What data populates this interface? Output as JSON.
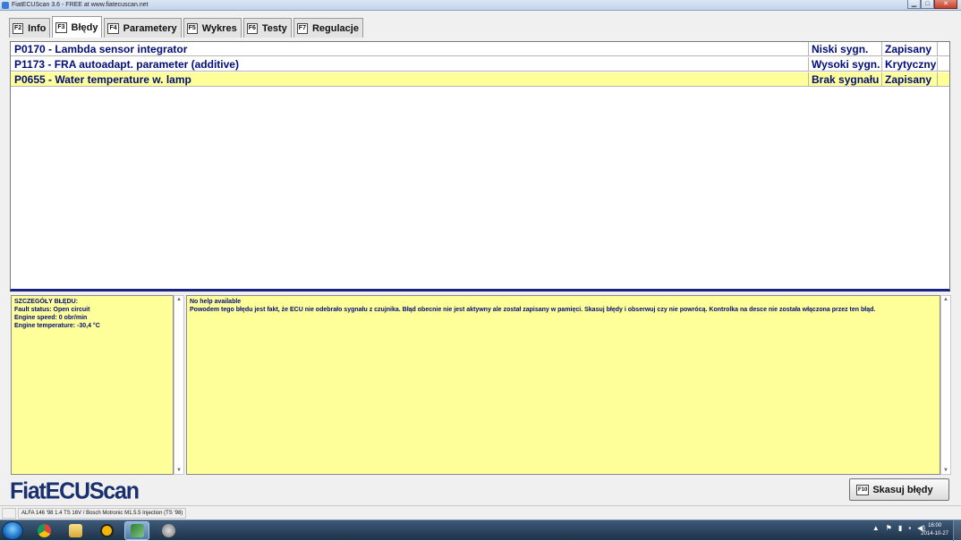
{
  "window": {
    "title": "FiatECUScan 3.6 - FREE at www.fiatecuscan.net"
  },
  "tabs": [
    {
      "key": "F2",
      "label": "Info"
    },
    {
      "key": "F3",
      "label": "Błędy"
    },
    {
      "key": "F4",
      "label": "Parametery"
    },
    {
      "key": "F5",
      "label": "Wykres"
    },
    {
      "key": "F6",
      "label": "Testy"
    },
    {
      "key": "F7",
      "label": "Regulacje"
    }
  ],
  "active_tab": "Błędy",
  "faults": [
    {
      "code_desc": "P0170 - Lambda sensor integrator",
      "signal": "Niski sygn.",
      "status": "Zapisany"
    },
    {
      "code_desc": "P1173 - FRA autoadapt. parameter (additive)",
      "signal": "Wysoki sygn.",
      "status": "Krytyczny"
    },
    {
      "code_desc": "P0655 - Water temperature w. lamp",
      "signal": "Brak sygnału",
      "status": "Zapisany"
    }
  ],
  "selected_fault_index": 2,
  "details": {
    "heading": "SZCZEGÓŁY BŁĘDU:",
    "lines": [
      "Fault status: Open circuit",
      "Engine speed: 0 obr/min",
      "Engine temperature: -30,4 °C"
    ]
  },
  "help": {
    "title": "No help available",
    "text": "Powodem tego błędu jest fakt, że ECU nie odebrało sygnału z czujnika. Błąd obecnie nie jest aktywny ale został zapisany w pamięci. Skasuj błędy i obserwuj czy nie powrócą. Kontrolka na desce nie została włączona przez ten błąd."
  },
  "logo": "FiatECUScan",
  "clear_button": {
    "key": "F10",
    "label": "Skasuj błędy"
  },
  "statusbar": {
    "vehicle": "ALFA 146 '98 1.4 TS 16V / Bosch Motronic M1.5.5 Injection (TS '98)"
  },
  "taskbar": {
    "time": "16:00",
    "date": "2014-10-27"
  },
  "colors": {
    "highlight": "#ffff99",
    "text_blue": "#000d7a",
    "logo": "#1a2f6e"
  }
}
